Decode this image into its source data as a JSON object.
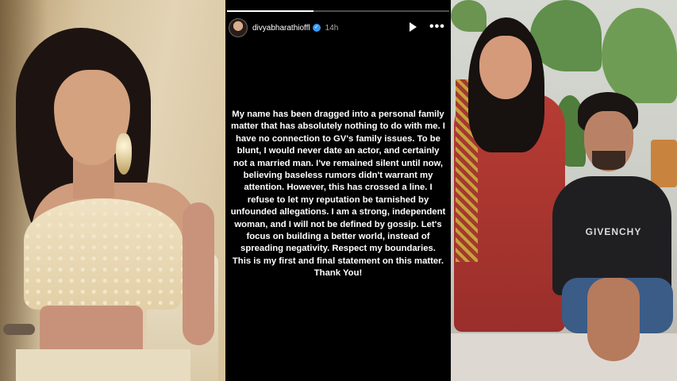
{
  "story": {
    "username": "divyabharathioffl",
    "verified_icon": "verified-badge-icon",
    "time": "14h",
    "progress": 0.39,
    "controls": {
      "play_icon": "play-icon",
      "more_icon": "more-options-icon"
    },
    "statement": "My name has been dragged into a personal family matter that has absolutely nothing to do with me. I have no connection to GV's family issues. To be blunt, I would never date an actor, and certainly not a married man. I've remained silent until now, believing baseless rumors didn't warrant my attention. However, this has crossed a line. I refuse to let my reputation be tarnished by unfounded allegations. I am a strong, independent woman, and I will not be defined by gossip. Let's focus on building a better world, instead of spreading negativity. Respect my boundaries. This is my first and final statement on this matter. Thank You!"
  },
  "right_photo": {
    "sweater_logo": "GIVENCHY"
  },
  "colors": {
    "story_background": "#000000",
    "text": "#ffffff",
    "verified": "#3897f0"
  }
}
